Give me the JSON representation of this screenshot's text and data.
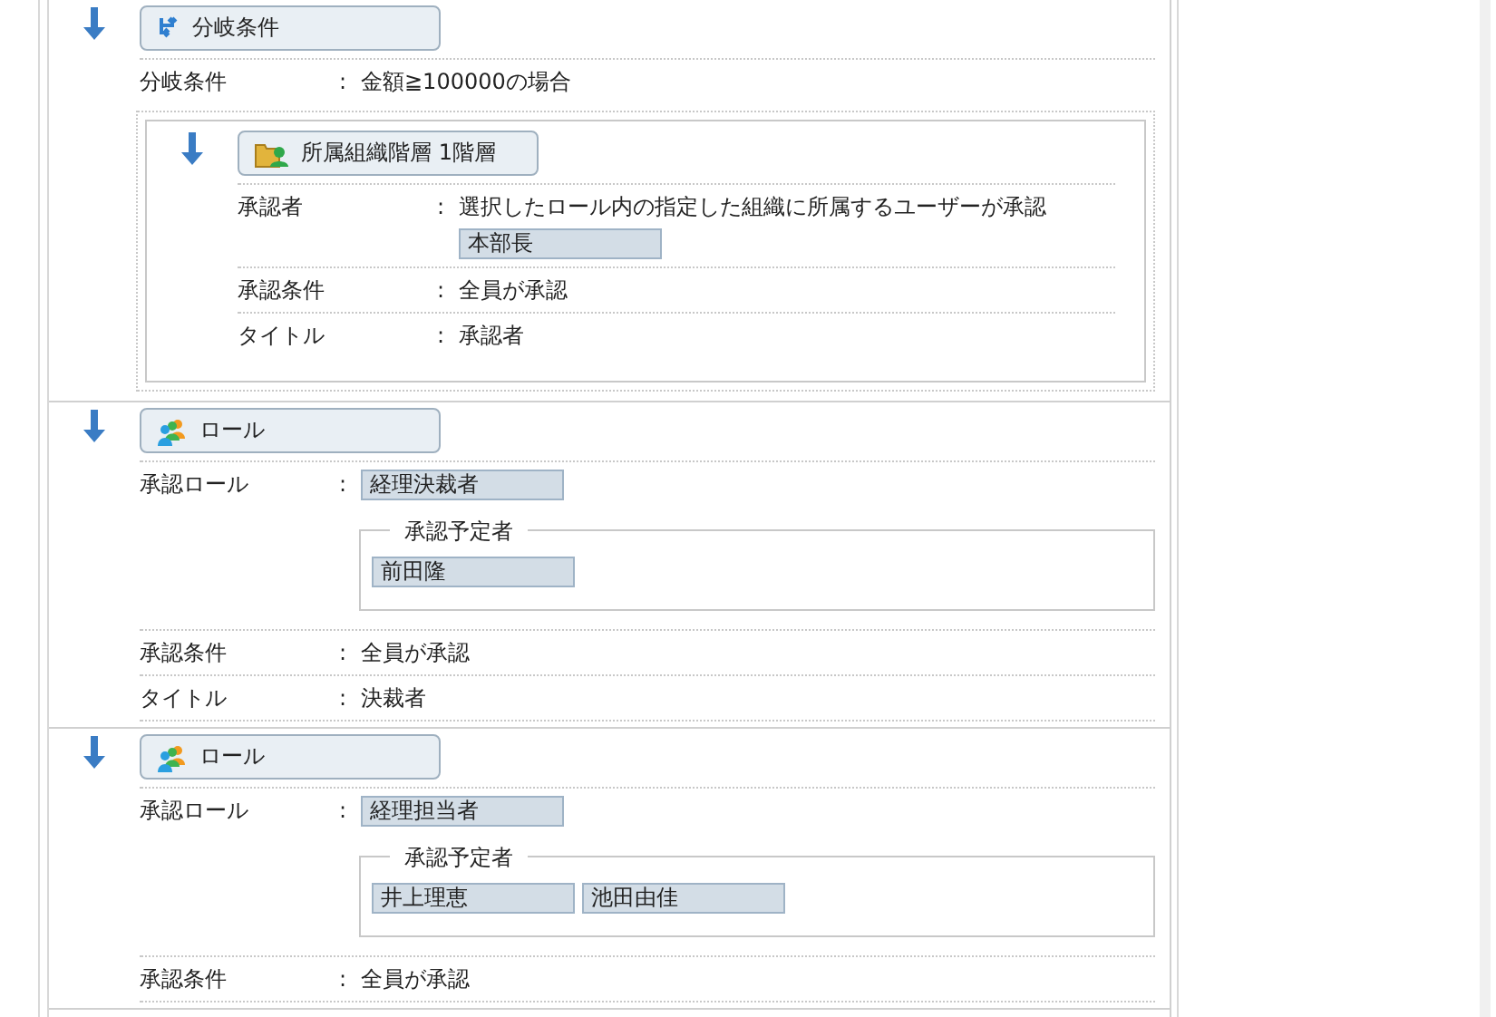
{
  "steps": [
    {
      "kind": "branch",
      "title": "分岐条件",
      "fields": [
        {
          "label": "分岐条件",
          "colon": ":",
          "value": "金額≧100000の場合"
        }
      ],
      "children": [
        {
          "kind": "org",
          "title": "所属組織階層 1階層",
          "fields": [
            {
              "label": "承認者",
              "colon": ":",
              "value": "選択したロール内の指定した組織に所属するユーザーが承認",
              "tags": [
                "本部長"
              ]
            },
            {
              "label": "承認条件",
              "colon": ":",
              "value": "全員が承認"
            },
            {
              "label": "タイトル",
              "colon": ":",
              "value": "承認者"
            }
          ]
        }
      ]
    },
    {
      "kind": "role",
      "title": "ロール",
      "fields": [
        {
          "label": "承認ロール",
          "colon": ":",
          "tags": [
            "経理決裁者"
          ],
          "group": {
            "legend": "承認予定者",
            "tags": [
              "前田隆"
            ]
          }
        },
        {
          "label": "承認条件",
          "colon": ":",
          "value": "全員が承認"
        },
        {
          "label": "タイトル",
          "colon": ":",
          "value": "決裁者"
        }
      ]
    },
    {
      "kind": "role",
      "title": "ロール",
      "fields": [
        {
          "label": "承認ロール",
          "colon": ":",
          "tags": [
            "経理担当者"
          ],
          "group": {
            "legend": "承認予定者",
            "tags": [
              "井上理恵",
              "池田由佳"
            ]
          }
        },
        {
          "label": "承認条件",
          "colon": ":",
          "value": "全員が承認"
        }
      ]
    }
  ]
}
